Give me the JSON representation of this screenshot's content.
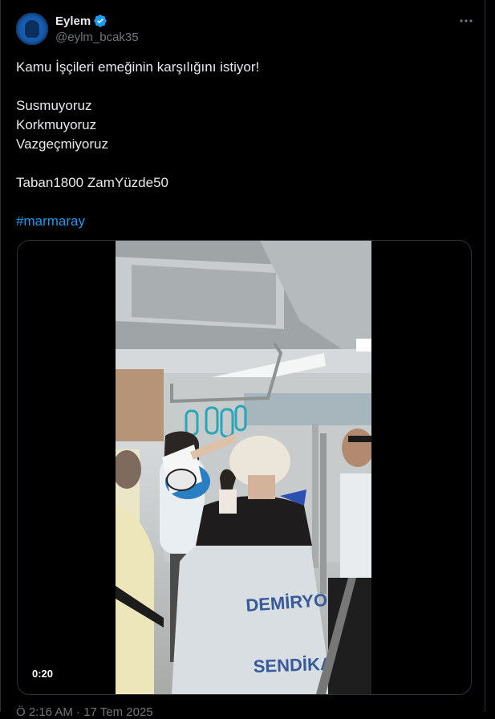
{
  "tweet": {
    "author_name": "Eylem",
    "author_handle": "@eylm_bcak35",
    "more_icon": "more-horizontal-icon",
    "verified_icon": "verified-badge-icon",
    "text_lines": [
      "Kamu İşçileri emeğinin karşılığını istiyor!",
      "",
      "Susmuyoruz",
      "Korkmuyoruz",
      "Vazgeçmiyoruz",
      "",
      "Taban1800 ZamYüzde50",
      ""
    ],
    "hashtag": "#marmaray",
    "video": {
      "duration": "0:20",
      "vest_text_line1": "DEMİRYOL",
      "vest_text_line2": "SENDİKA"
    },
    "meta_partial": "Ö 2:16 AM · 17 Tem 2025"
  },
  "colors": {
    "background": "#000000",
    "text": "#e7e9ea",
    "secondary": "#71767b",
    "accent": "#1d9bf0",
    "border": "#2f3336"
  }
}
